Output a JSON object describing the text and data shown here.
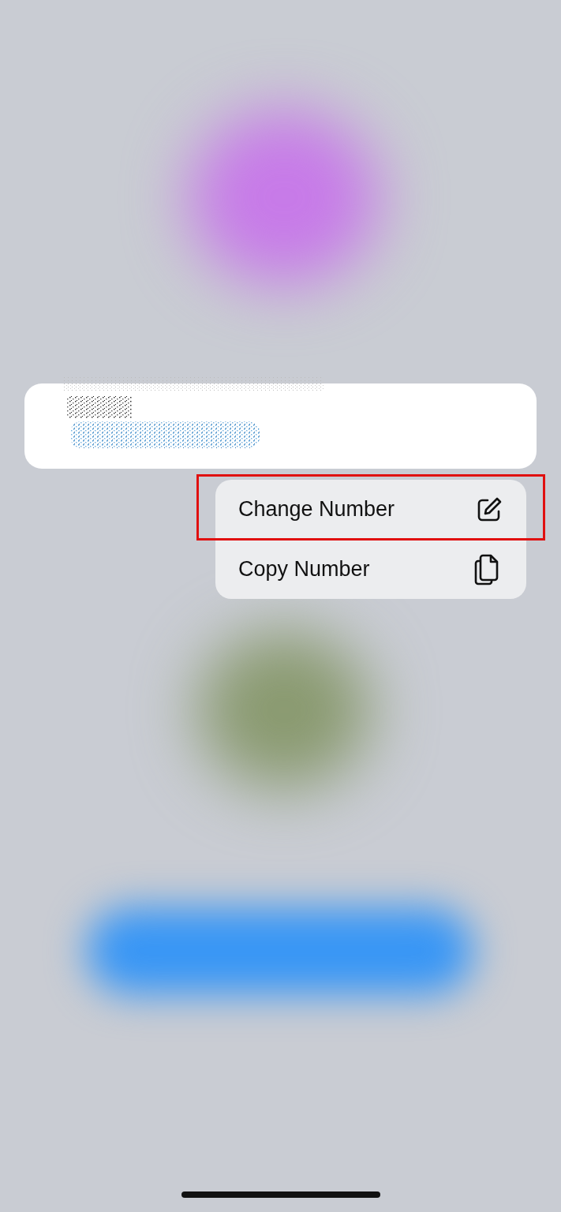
{
  "context_menu": {
    "items": [
      {
        "label": "Change Number",
        "kind": "edit",
        "highlighted": true
      },
      {
        "label": "Copy Number",
        "kind": "copy",
        "highlighted": false
      }
    ]
  }
}
